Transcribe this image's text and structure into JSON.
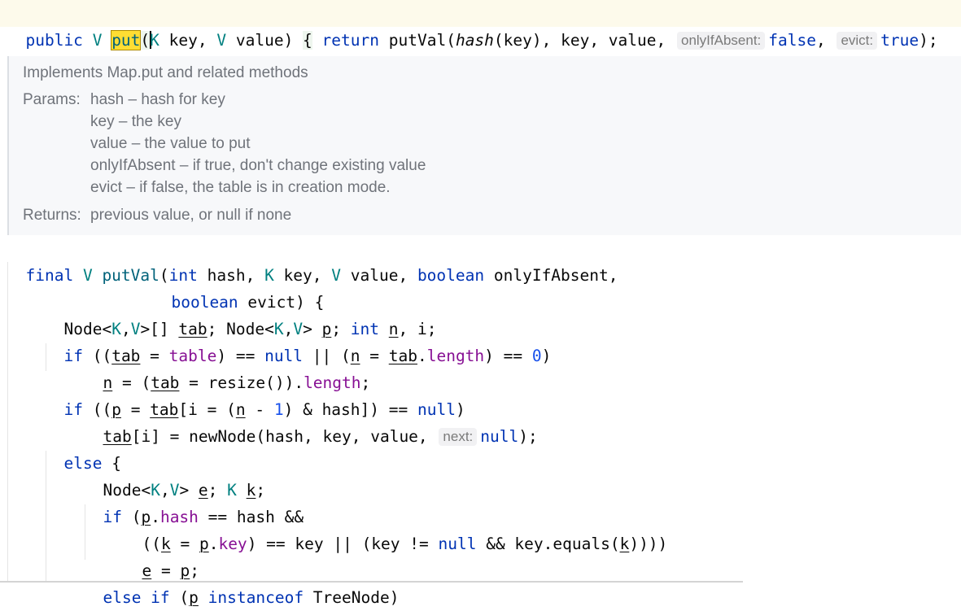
{
  "signature": {
    "public_kw": "public",
    "type_v": "V",
    "method_name": "put",
    "open_paren": "(",
    "type_k": "K",
    "params_text": " key, ",
    "type_v2": "V",
    "params_text2": " value) ",
    "brace": "{",
    "return_kw": "return",
    "call_name": "putVal",
    "hash_call": "hash",
    "call_args": "(key), key, value, ",
    "hint_only_if_absent": "onlyIfAbsent:",
    "false_kw": "false",
    "comma": ", ",
    "hint_evict": "evict:",
    "true_kw": "true",
    "end": ");"
  },
  "doc": {
    "summary": "Implements Map.put and related methods",
    "params_label": "Params:",
    "params": [
      "hash – hash for key",
      "key – the key",
      "value – the value to put",
      "onlyIfAbsent – if true, don't change existing value",
      "evict – if false, the table is in creation mode."
    ],
    "returns_label": "Returns:",
    "returns": "previous value, or null if none"
  },
  "code": {
    "l1": {
      "final_kw": "final",
      "v": "V",
      "name": "putVal",
      "p1": "(",
      "int_kw": "int",
      "p2": " hash, ",
      "k": "K",
      "p3": " key, ",
      "v2": "V",
      "p4": " value, ",
      "boolean_kw": "boolean",
      "p5": " onlyIfAbsent,"
    },
    "l2": {
      "boolean_kw": "boolean",
      "rest": " evict) {"
    },
    "l3": {
      "a": "Node<",
      "k": "K",
      "c1": ",",
      "v": "V",
      "b": ">[] ",
      "tab": "tab",
      "c": "; Node<",
      "k2": "K",
      "c2": ",",
      "v2": "V",
      "d": "> ",
      "p": "p",
      "e": "; ",
      "int_kw": "int",
      "f": " ",
      "n": "n",
      "g": ", i;"
    },
    "l4": {
      "if_kw": "if",
      "a": " ((",
      "tab": "tab",
      "b": " = ",
      "table": "table",
      "c": ") == ",
      "null_kw": "null",
      "d": " || (",
      "n": "n",
      "e": " = ",
      "tab2": "tab",
      "f": ".",
      "length": "length",
      "g": ") == ",
      "zero": "0",
      "h": ")"
    },
    "l5": {
      "n": "n",
      "a": " = (",
      "tab": "tab",
      "b": " = resize()).",
      "length": "length",
      "c": ";"
    },
    "l6": {
      "if_kw": "if",
      "a": " ((",
      "p": "p",
      "b": " = ",
      "tab": "tab",
      "c": "[i = (",
      "n": "n",
      "d": " - ",
      "one": "1",
      "e": ") & hash]) == ",
      "null_kw": "null",
      "f": ")"
    },
    "l7": {
      "tab": "tab",
      "a": "[i] = newNode(hash, key, value, ",
      "hint_next": "next:",
      "null_kw": "null",
      "b": ");"
    },
    "l8": {
      "else_kw": "else",
      "a": " {"
    },
    "l9": {
      "a": "Node<",
      "k": "K",
      "c1": ",",
      "v": "V",
      "b": "> ",
      "e": "e",
      "c": "; ",
      "k2": "K",
      "d": " ",
      "kvar": "k",
      "f": ";"
    },
    "l10": {
      "if_kw": "if",
      "a": " (",
      "p": "p",
      "b": ".",
      "hash": "hash",
      "c": " == hash &&"
    },
    "l11": {
      "a": "((",
      "k": "k",
      "b": " = ",
      "p": "p",
      "c": ".",
      "key": "key",
      "d": ") == key || (key != ",
      "null_kw": "null",
      "e": " && key.equals(",
      "k2": "k",
      "f": "))))"
    },
    "l12": {
      "e": "e",
      "a": " = ",
      "p": "p",
      "b": ";"
    },
    "l13": {
      "else_kw": "else if",
      "a": " (",
      "p": "p",
      "b": " ",
      "instanceof_kw": "instanceof",
      "c": " TreeNode)"
    }
  }
}
